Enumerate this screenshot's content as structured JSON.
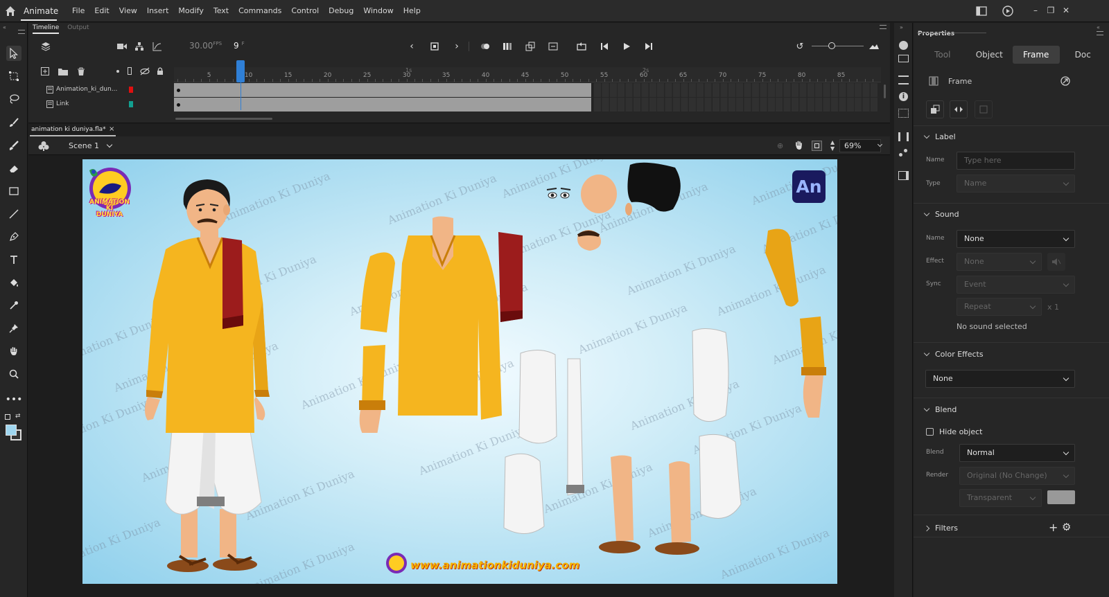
{
  "app": {
    "name": "Animate",
    "menus": [
      "File",
      "Edit",
      "View",
      "Insert",
      "Modify",
      "Text",
      "Commands",
      "Control",
      "Debug",
      "Window",
      "Help"
    ]
  },
  "timeline": {
    "tabs": [
      "Timeline",
      "Output"
    ],
    "fps": "30.00",
    "fps_unit": "FPS",
    "current_frame": "9",
    "frame_unit": "F",
    "ruler_ticks": [
      "5",
      "10",
      "15",
      "20",
      "25",
      "30",
      "35",
      "40",
      "45",
      "50",
      "55",
      "60",
      "65",
      "70",
      "75",
      "80",
      "85"
    ],
    "seconds": [
      "1s",
      "2s"
    ],
    "playhead_frame": 9,
    "layers": [
      {
        "name": "Animation_ki_dun...",
        "color": "#e01010"
      },
      {
        "name": "Link",
        "color": "#12a090"
      }
    ]
  },
  "document": {
    "tab_title": "animation ki duniya.fla*",
    "close_glyph": "×",
    "scene": "Scene 1",
    "zoom": "69%"
  },
  "stage": {
    "watermark": "Animation Ki Duniya",
    "logo_text": "An",
    "website": "www.animationkiduniya.com",
    "brand_lines": [
      "ANIMATION",
      "KI",
      "DUNIYA"
    ]
  },
  "properties": {
    "title": "Properties",
    "tabs": [
      "Tool",
      "Object",
      "Frame",
      "Doc"
    ],
    "active_tab": "Frame",
    "frame_header": "Frame",
    "label": {
      "section": "Label",
      "name_label": "Name",
      "name_placeholder": "Type here",
      "type_label": "Type",
      "type_value": "Name"
    },
    "sound": {
      "section": "Sound",
      "name_label": "Name",
      "name_value": "None",
      "effect_label": "Effect",
      "effect_value": "None",
      "sync_label": "Sync",
      "sync_value": "Event",
      "repeat_value": "Repeat",
      "repeat_count": "x 1",
      "status": "No sound selected"
    },
    "color_effects": {
      "section": "Color Effects",
      "value": "None"
    },
    "blend": {
      "section": "Blend",
      "hide_object": "Hide object",
      "blend_label": "Blend",
      "blend_value": "Normal",
      "render_label": "Render",
      "render_value": "Original (No Change)",
      "transparent_value": "Transparent"
    },
    "filters": {
      "section": "Filters"
    }
  },
  "colors": {
    "accent": "#2f7fd6",
    "kurta": "#f5b51f",
    "kurta_dark": "#d98f0a",
    "scarf": "#9c1c1c",
    "skin": "#f1b586",
    "dhoti": "#f4f4f4",
    "hair": "#1a1a1a",
    "an_logo_bg": "#1a1a5e",
    "an_logo_fg": "#9ab4ff"
  }
}
